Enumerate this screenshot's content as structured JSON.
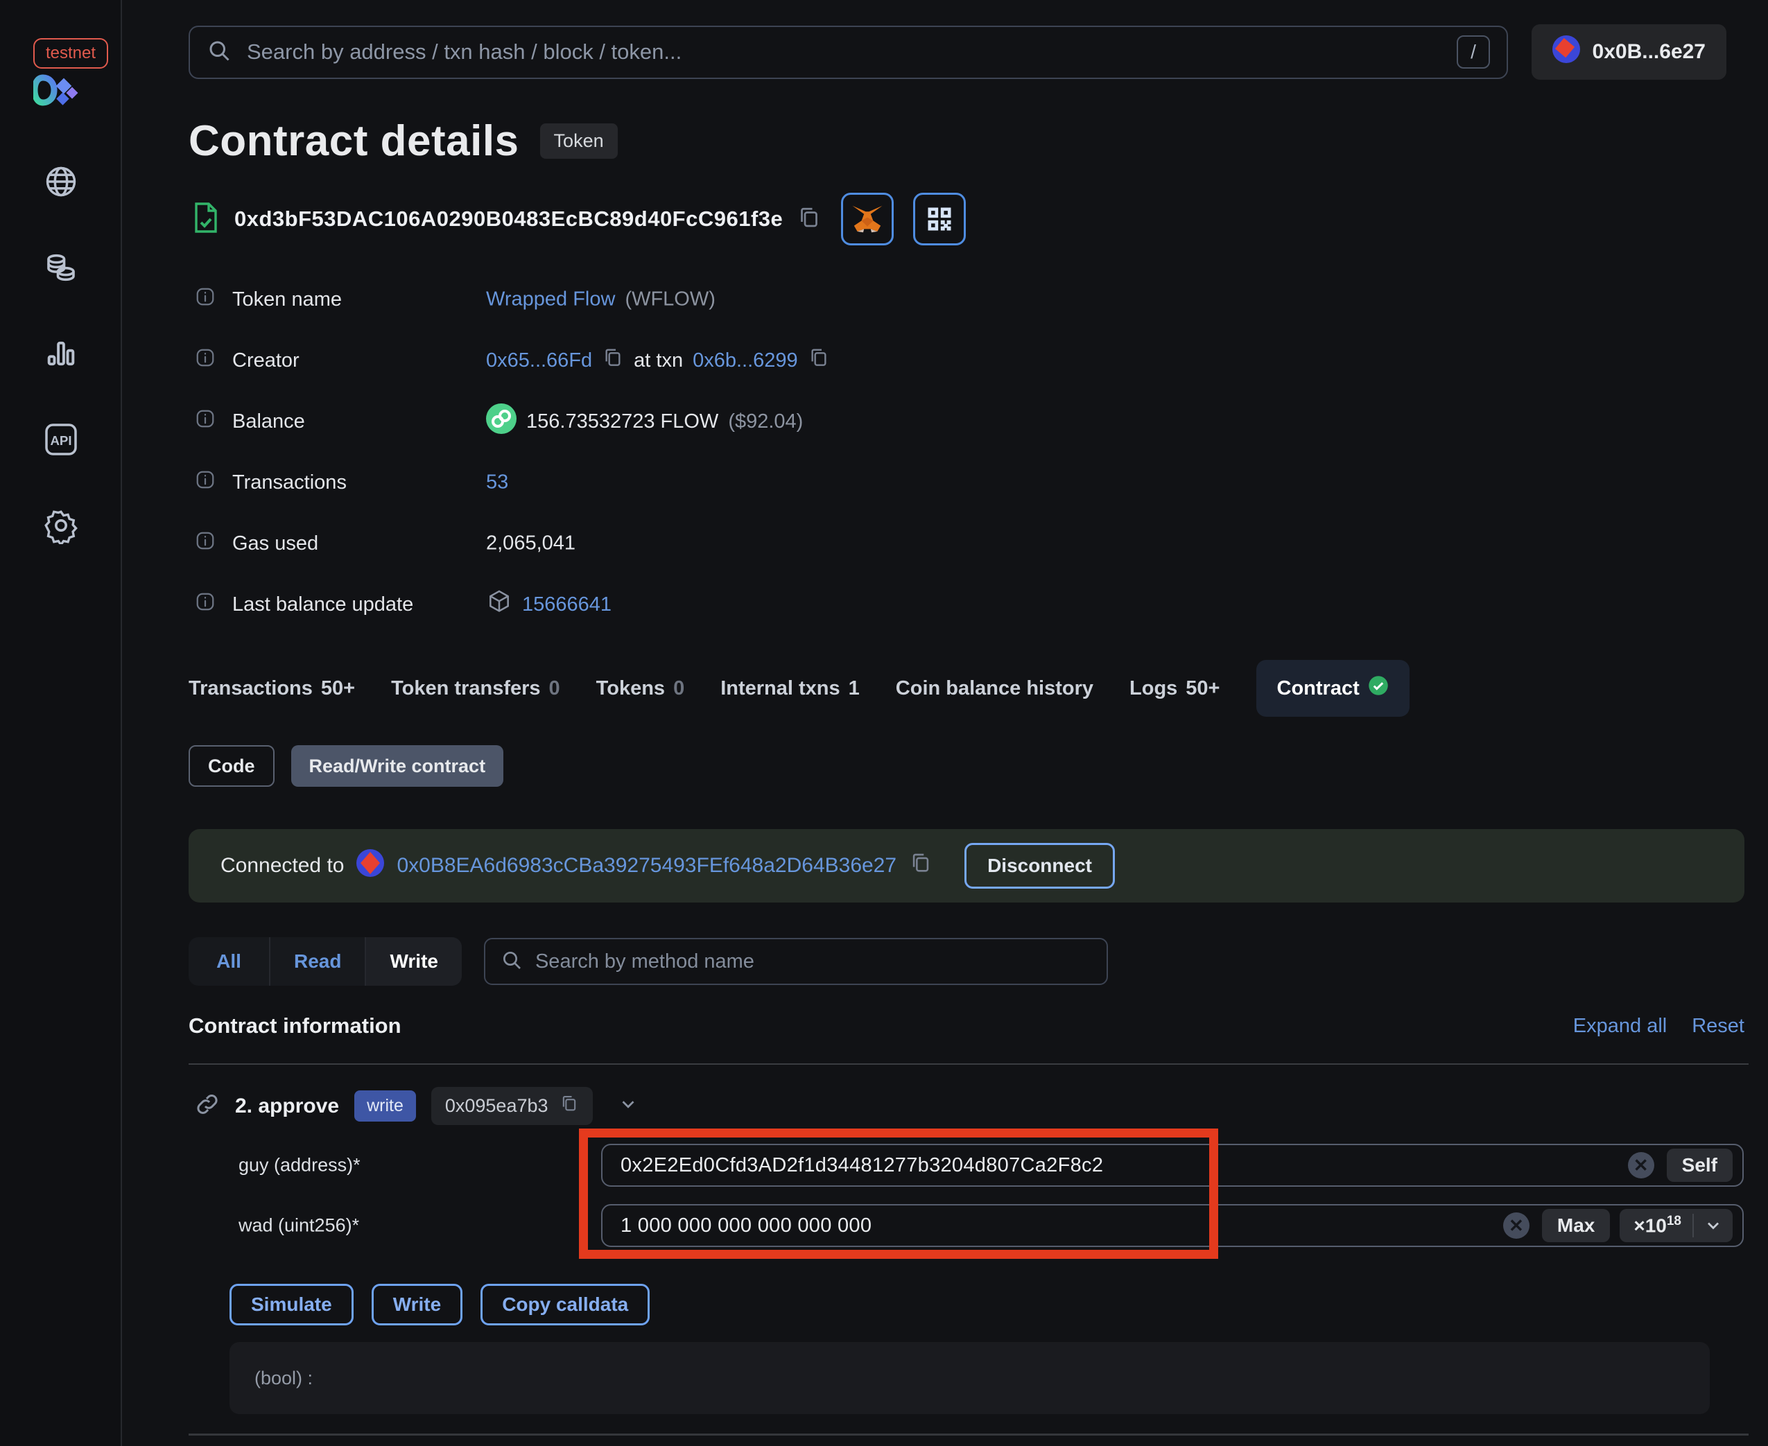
{
  "sidebar": {
    "env_badge": "testnet",
    "nav": [
      "network",
      "tokens",
      "stats",
      "api",
      "settings"
    ]
  },
  "topbar": {
    "search_placeholder": "Search by address / txn hash / block / token...",
    "shortcut_key": "/",
    "account_address": "0x0B...6e27"
  },
  "header": {
    "title": "Contract details",
    "type_badge": "Token",
    "contract_address": "0xd3bF53DAC106A0290B0483EcBC89d40FcC961f3e"
  },
  "info": {
    "token_name": {
      "label": "Token name",
      "link": "Wrapped Flow",
      "symbol": "(WFLOW)"
    },
    "creator": {
      "label": "Creator",
      "address": "0x65...66Fd",
      "at_txn": "at txn",
      "txn": "0x6b...6299"
    },
    "balance": {
      "label": "Balance",
      "amount": "156.73532723 FLOW",
      "usd": "($92.04)"
    },
    "transactions": {
      "label": "Transactions",
      "value": "53"
    },
    "gas_used": {
      "label": "Gas used",
      "value": "2,065,041"
    },
    "last_update": {
      "label": "Last balance update",
      "value": "15666641"
    }
  },
  "tabs": [
    {
      "label": "Transactions",
      "count": "50+"
    },
    {
      "label": "Token transfers",
      "count": "0"
    },
    {
      "label": "Tokens",
      "count": "0"
    },
    {
      "label": "Internal txns",
      "count": "1"
    },
    {
      "label": "Coin balance history",
      "count": ""
    },
    {
      "label": "Logs",
      "count": "50+"
    },
    {
      "label": "Contract",
      "count": ""
    }
  ],
  "subtabs": {
    "code": "Code",
    "read_write": "Read/Write contract"
  },
  "connected": {
    "prefix": "Connected to",
    "address": "0x0B8EA6d6983cCBa39275493FEf648a2D64B36e27",
    "disconnect": "Disconnect"
  },
  "filter": {
    "all": "All",
    "read": "Read",
    "write": "Write",
    "search_placeholder": "Search by method name"
  },
  "section": {
    "title": "Contract information",
    "expand_all": "Expand all",
    "reset": "Reset"
  },
  "method": {
    "name": "2. approve",
    "badge": "write",
    "signature": "0x095ea7b3"
  },
  "fields": {
    "guy": {
      "label": "guy (address)*",
      "value": "0x2E2Ed0Cfd3AD2f1d34481277b3204d807Ca2F8c2",
      "action": "Self"
    },
    "wad": {
      "label": "wad (uint256)*",
      "value": "1 000 000 000 000 000 000",
      "action": "Max",
      "multiplier": "×10",
      "exponent": "18"
    }
  },
  "actions": {
    "simulate": "Simulate",
    "write": "Write",
    "copy": "Copy calldata"
  },
  "output": {
    "result": "(bool) :"
  },
  "colors": {
    "link_blue": "#6796dc",
    "annotation_red": "#e43a1d",
    "verified_green": "#32b469",
    "flow_green": "#4ed08a",
    "write_badge_blue": "#3e56a5",
    "action_border_blue": "#6ea2f0",
    "banner_green_bg": "#252c26"
  }
}
